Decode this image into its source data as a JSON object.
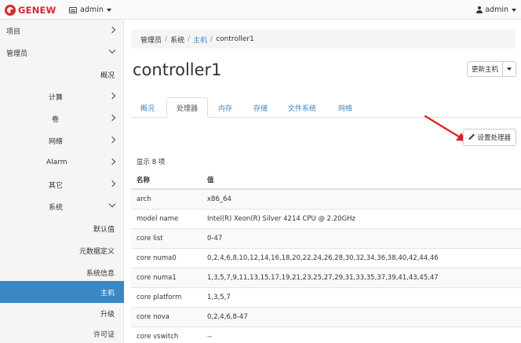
{
  "brand": {
    "name": "GENEW"
  },
  "topbar": {
    "project_label": "admin",
    "user_label": "admin"
  },
  "sidebar": {
    "items": [
      {
        "label": "项目"
      },
      {
        "label": "管理员"
      },
      {
        "label": "概况"
      },
      {
        "label": "计算"
      },
      {
        "label": "卷"
      },
      {
        "label": "网络"
      },
      {
        "label": "Alarm"
      },
      {
        "label": "其它"
      },
      {
        "label": "系统"
      },
      {
        "label": "默认值"
      },
      {
        "label": "元数据定义"
      },
      {
        "label": "系统信息"
      },
      {
        "label": "主机"
      },
      {
        "label": "升级"
      },
      {
        "label": "许可证"
      }
    ]
  },
  "breadcrumb": {
    "items": [
      "管理员",
      "系统",
      "主机",
      "controller1"
    ]
  },
  "page": {
    "title": "controller1",
    "update_button": "更新主机"
  },
  "tabs": [
    {
      "label": "概况"
    },
    {
      "label": "处理器"
    },
    {
      "label": "内存"
    },
    {
      "label": "存储"
    },
    {
      "label": "文件系统"
    },
    {
      "label": "网络"
    }
  ],
  "actions": {
    "configure_cpu": "设置处理器"
  },
  "table": {
    "count_text": "显示 8 项",
    "headers": [
      "名称",
      "值"
    ],
    "rows": [
      [
        "arch",
        "x86_64"
      ],
      [
        "model name",
        "Intel(R) Xeon(R) Silver 4214 CPU @ 2.20GHz"
      ],
      [
        "core list",
        "0-47"
      ],
      [
        "core numa0",
        "0,2,4,6,8,10,12,14,16,18,20,22,24,26,28,30,32,34,36,38,40,42,44,46"
      ],
      [
        "core numa1",
        "1,3,5,7,9,11,13,15,17,19,21,23,25,27,29,31,33,35,37,39,41,43,45,47"
      ],
      [
        "core platform",
        "1,3,5,7"
      ],
      [
        "core nova",
        "0,2,4,6,8-47"
      ],
      [
        "core vswitch",
        "--"
      ]
    ]
  },
  "colors": {
    "brand": "#d9282f",
    "link": "#3a87c6",
    "active_nav": "#3a87c6",
    "annotation_arrow": "#e02020"
  }
}
